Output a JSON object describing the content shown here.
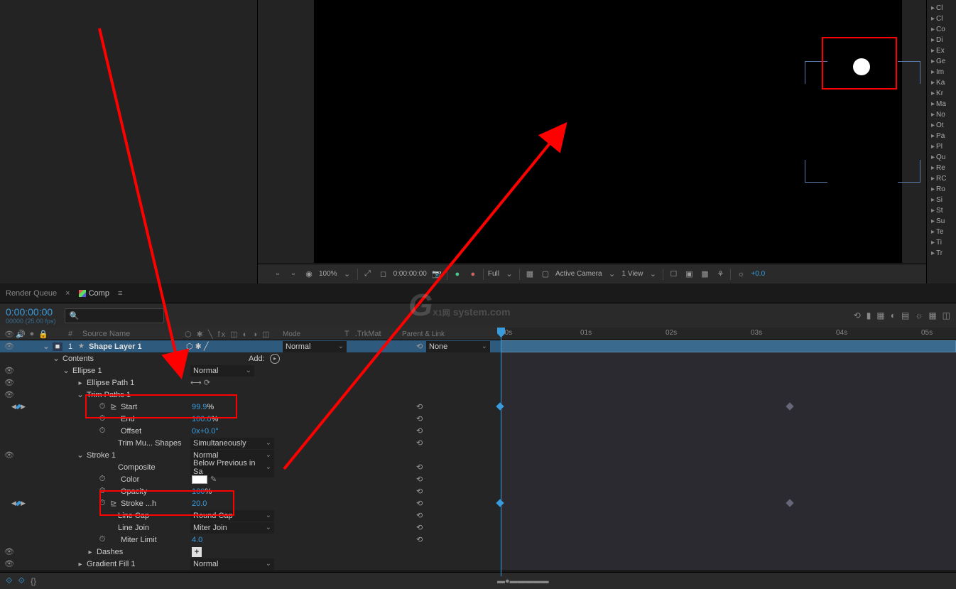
{
  "tabs": {
    "renderQueue": "Render Queue",
    "comp": "Comp"
  },
  "timecode": {
    "main": "0:00:00:00",
    "sub": "00000 (25.00 fps)"
  },
  "columns": {
    "num": "#",
    "sourceName": "Source Name",
    "mode": "Mode",
    "t": "T",
    "trkmat": ".TrkMat",
    "parent": "Parent & Link"
  },
  "viewer": {
    "zoom": "100%",
    "time": "0:00:00:00",
    "quality": "Full",
    "camera": "Active Camera",
    "views": "1 View",
    "expVal": "+0.0"
  },
  "layer1": {
    "num": "1",
    "name": "Shape Layer 1",
    "mode": "Normal",
    "parent": "None"
  },
  "contents": {
    "label": "Contents",
    "add": "Add:"
  },
  "ellipse": {
    "label": "Ellipse 1",
    "mode": "Normal",
    "path": "Ellipse Path 1"
  },
  "trim": {
    "label": "Trim Paths 1",
    "startLabel": "Start",
    "startVal": "99.9",
    "startUnit": "%",
    "endLabel": "End",
    "endVal": "100.0",
    "endUnit": "%",
    "offsetLabel": "Offset",
    "offsetVal": "0x+0.0°",
    "shapesLabel": "Trim Mu... Shapes",
    "shapesVal": "Simultaneously"
  },
  "stroke": {
    "label": "Stroke 1",
    "mode": "Normal",
    "composite": "Composite",
    "compositeVal": "Below Previous in Sa",
    "color": "Color",
    "opacity": "Opacity",
    "opacityVal": "100",
    "opacityUnit": "%",
    "width": "Stroke ...h",
    "widthVal": "20.0",
    "lineCap": "Line Cap",
    "lineCapVal": "Round Cap",
    "lineJoin": "Line Join",
    "lineJoinVal": "Miter Join",
    "miterLimit": "Miter Limit",
    "miterLimitVal": "4.0",
    "dashes": "Dashes"
  },
  "gradientFill": {
    "label": "Gradient Fill 1",
    "mode": "Normal"
  },
  "ruler": {
    "t0": "00s",
    "t1": "01s",
    "t2": "02s",
    "t3": "03s",
    "t4": "04s",
    "t5": "05s"
  },
  "rightPanel": {
    "i0": "Cl",
    "i1": "Cl",
    "i2": "Co",
    "i3": "Di",
    "i4": "Ex",
    "i5": "Ge",
    "i6": "Im",
    "i7": "Ka",
    "i8": "Kr",
    "i9": "Ma",
    "i10": "No",
    "i11": "Ot",
    "i12": "Pa",
    "i13": "Pl",
    "i14": "Qu",
    "i15": "Re",
    "i16": "RC",
    "i17": "Ro",
    "i18": "Si",
    "i19": "St",
    "i20": "Su",
    "i21": "Te",
    "i22": "Ti",
    "i23": "Tr"
  },
  "watermark": {
    "main": "X1网",
    "sub": "system.com",
    "g": "G"
  }
}
